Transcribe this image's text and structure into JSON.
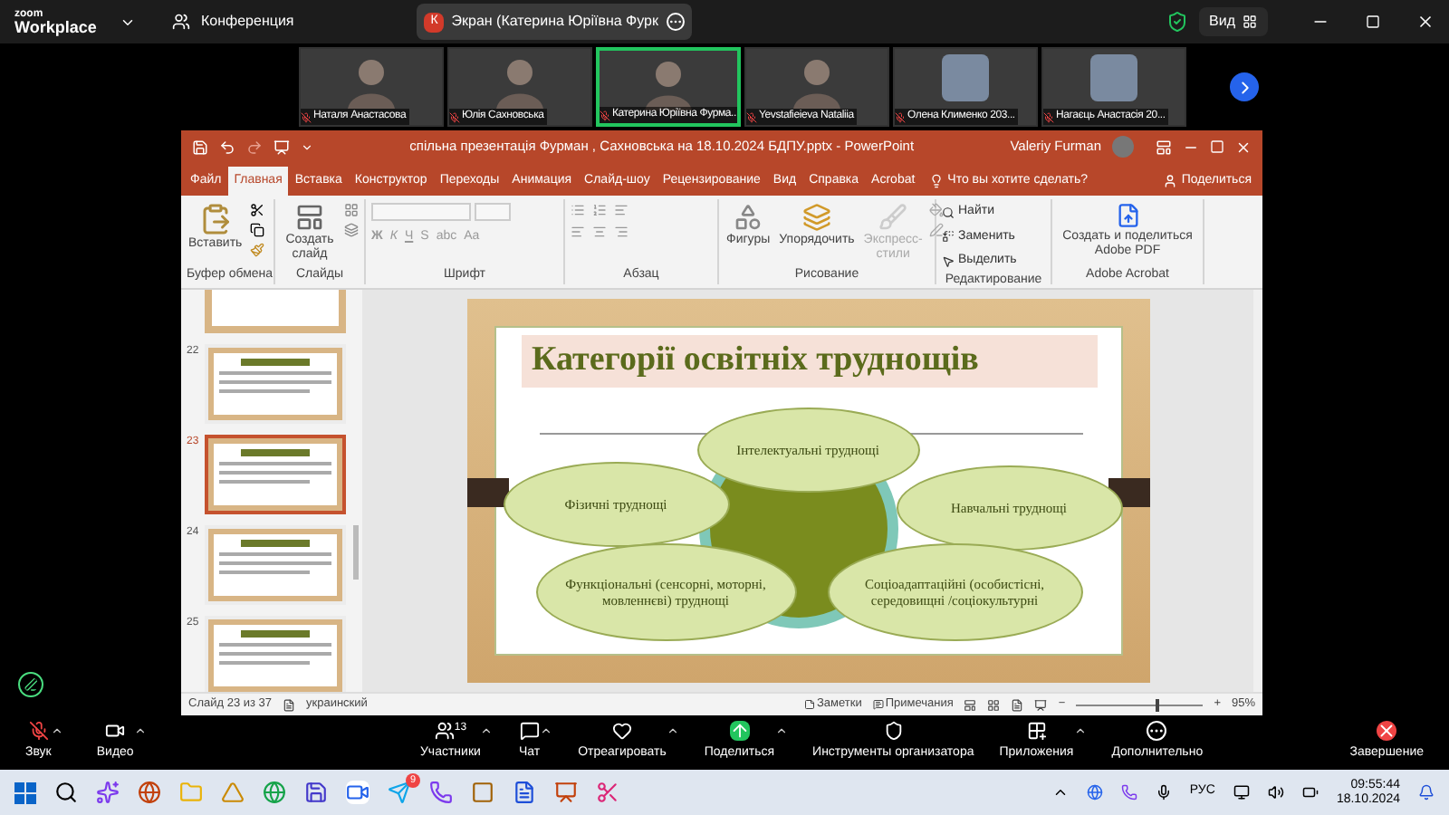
{
  "zoom_header": {
    "brand_top": "zoom",
    "brand_bottom": "Workplace",
    "meeting": "Конференция",
    "share_tab": {
      "badge": "К",
      "label": "Экран (Катерина Юріївна Фурк"
    },
    "view": "Вид"
  },
  "participants": [
    {
      "name": "Наталя Анастасова",
      "muted": true,
      "selected": false
    },
    {
      "name": "Юлія Сахновська",
      "muted": true,
      "selected": false
    },
    {
      "name": "Катерина Юріївна Фурма...",
      "muted": true,
      "selected": true
    },
    {
      "name": "Yevstafieieva Nataliia",
      "muted": true,
      "selected": false
    },
    {
      "name": "Олена Клименко 203...",
      "muted": true,
      "selected": false
    },
    {
      "name": "Нагаєць Анастасія 20...",
      "muted": true,
      "selected": false
    }
  ],
  "powerpoint": {
    "title": "спільна презентація Фурман , Сахновська на 18.10.2024 БДПУ.pptx  -  PowerPoint",
    "user": "Valeriy Furman",
    "tabs": [
      {
        "label": "Файл",
        "selected": false
      },
      {
        "label": "Главная",
        "selected": true
      },
      {
        "label": "Вставка",
        "selected": false
      },
      {
        "label": "Конструктор",
        "selected": false
      },
      {
        "label": "Переходы",
        "selected": false
      },
      {
        "label": "Анимация",
        "selected": false
      },
      {
        "label": "Слайд-шоу",
        "selected": false
      },
      {
        "label": "Рецензирование",
        "selected": false
      },
      {
        "label": "Вид",
        "selected": false
      },
      {
        "label": "Справка",
        "selected": false
      },
      {
        "label": "Acrobat",
        "selected": false
      }
    ],
    "tell_me": "Что вы хотите сделать?",
    "share": "Поделиться",
    "ribbon": {
      "clipboard": {
        "label": "Буфер обмена",
        "paste": "Вставить"
      },
      "slides": {
        "label": "Слайды",
        "new_slide": "Создать слайд"
      },
      "font": {
        "label": "Шрифт",
        "format_buttons": [
          "Ж",
          "К",
          "Ч",
          "S",
          "abc",
          "Aa"
        ]
      },
      "paragraph": {
        "label": "Абзац"
      },
      "drawing": {
        "label": "Рисование",
        "shapes": "Фигуры",
        "arrange": "Упорядочить",
        "quick_styles": {
          "label": "Экспресс-стили",
          "disabled": true
        }
      },
      "editing": {
        "label": "Редактирование",
        "find": "Найти",
        "replace": "Заменить",
        "select": "Выделить"
      },
      "acrobat": {
        "label": "Adobe Acrobat",
        "create": "Создать и поделиться Adobe PDF"
      }
    },
    "thumbnails": [
      {
        "number": "22",
        "selected": false
      },
      {
        "number": "23",
        "selected": true
      },
      {
        "number": "24",
        "selected": false
      },
      {
        "number": "25",
        "selected": false
      }
    ],
    "slide": {
      "title": "Категорії освітніх труднощів",
      "nodes": [
        "Інтелектуальні труднощі",
        "Фізичні труднощі",
        "Навчальні труднощі",
        "Функціональні (сенсорні, моторні, мовленнєві) труднощі",
        "Соціоадаптаційні (особистісні, середовищні /соціокультурні"
      ]
    },
    "status": {
      "slide_count": "Слайд 23 из 37",
      "language": "украинский",
      "notes": "Заметки",
      "comments": "Примечания",
      "zoom_out": "−",
      "zoom_slider": {
        "level": 0.62
      },
      "zoom_in": "+",
      "zoom_text": "95%"
    }
  },
  "toolbar": {
    "audio": {
      "label": "Звук",
      "muted": true
    },
    "video": "Видео",
    "participants": {
      "label": "Участники",
      "count": "13"
    },
    "chat": "Чат",
    "react": "Отреагировать",
    "share": "Поделиться",
    "host_tools": "Инструменты организатора",
    "apps": "Приложения",
    "more": "Дополнительно",
    "end": "Завершение"
  },
  "taskbar": {
    "telegram_badge": "9",
    "language": "РУС",
    "time": "09:55:44",
    "date": "18.10.2024"
  }
}
